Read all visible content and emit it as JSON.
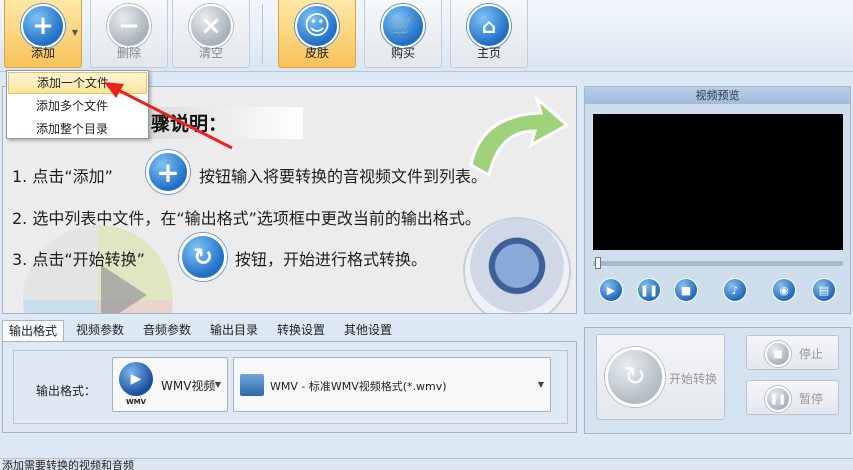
{
  "toolbar": {
    "add_label": "添加",
    "delete_label": "删除",
    "clear_label": "清空",
    "skin_label": "皮肤",
    "buy_label": "购买",
    "home_label": "主页"
  },
  "add_menu": {
    "items": [
      "添加一个文件",
      "添加多个文件",
      "添加整个目录"
    ]
  },
  "instructions": {
    "title": "步骤说明：",
    "title_visible": "骤说明：",
    "step1_a": "1. 点击“添加”",
    "step1_b": "按钮输入将要转换的音视频文件到列表。",
    "step2": "2. 选中列表中文件，在“输出格式”选项框中更改当前的输出格式。",
    "step3_a": "3. 点击“开始转换”",
    "step3_b": "按钮，开始进行格式转换。"
  },
  "preview": {
    "title": "视频预览"
  },
  "tabs": [
    "输出格式",
    "视频参数",
    "音频参数",
    "输出目录",
    "转换设置",
    "其他设置"
  ],
  "output": {
    "label": "输出格式：",
    "category_value": "WMV视频",
    "category_icon_text": "WMV",
    "format_value": "WMV - 标准WMV视频格式(*.wmv)"
  },
  "actions": {
    "start_label": "开始转换",
    "stop_label": "停止",
    "pause_label": "暂停"
  },
  "status": {
    "text": "添加需要转换的视频和音频"
  },
  "colors": {
    "accent": "#1f6fc6",
    "active_button": "#f7c25a",
    "annotation": "#e8231e"
  }
}
